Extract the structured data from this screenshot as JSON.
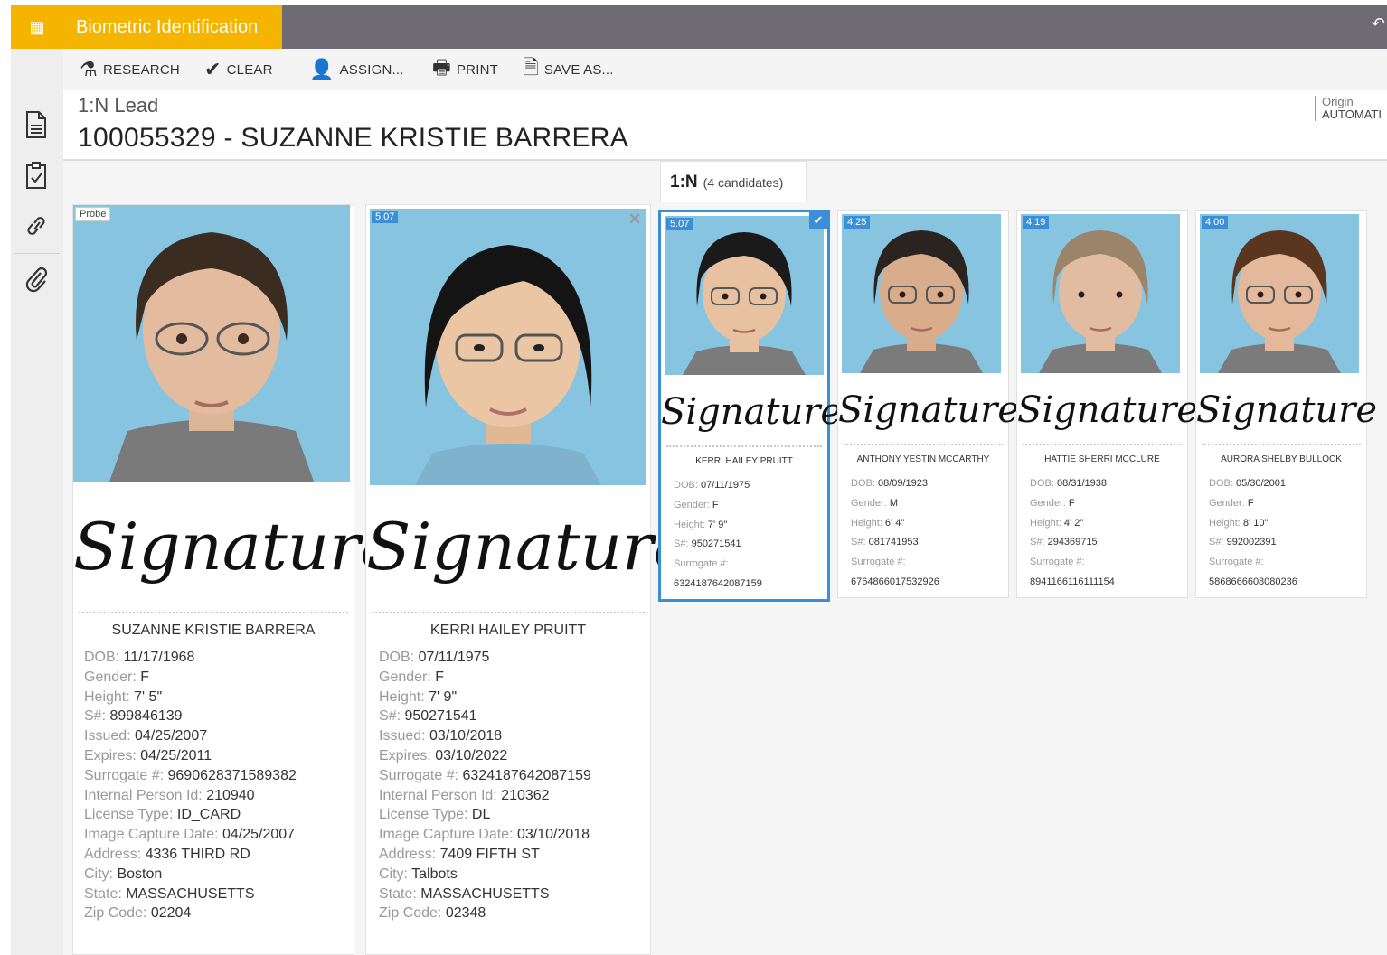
{
  "app": {
    "title": "Biometric Identification"
  },
  "toolbar": {
    "research": "RESEARCH",
    "clear": "CLEAR",
    "assign": "ASSIGN...",
    "print": "PRINT",
    "save_as": "SAVE AS..."
  },
  "header": {
    "lead": "1:N Lead",
    "title": "100055329 - SUZANNE KRISTIE BARRERA",
    "origin_label": "Origin",
    "origin_value": "AUTOMATI"
  },
  "tab": {
    "label": "1:N",
    "count": "(4 candidates)"
  },
  "signature_text": "Signature",
  "colors": {
    "accent": "#f5b400",
    "topbar": "#6f6b73",
    "selection": "#3b8fd6",
    "photo_bg": "#86c4e0"
  },
  "probe": {
    "badge": "Probe",
    "name": "SUZANNE KRISTIE BARRERA",
    "fields": [
      {
        "k": "DOB: ",
        "v": "11/17/1968"
      },
      {
        "k": "Gender: ",
        "v": "F"
      },
      {
        "k": "Height: ",
        "v": "7' 5\""
      },
      {
        "k": "S#: ",
        "v": "899846139"
      },
      {
        "k": "Issued: ",
        "v": "04/25/2007"
      },
      {
        "k": "Expires: ",
        "v": "04/25/2011"
      },
      {
        "k": "Surrogate #: ",
        "v": "9690628371589382"
      },
      {
        "k": "Internal Person Id: ",
        "v": "210940"
      },
      {
        "k": "License Type: ",
        "v": "ID_CARD"
      },
      {
        "k": "Image Capture Date: ",
        "v": "04/25/2007"
      },
      {
        "k": "Address: ",
        "v": "4336 THIRD RD"
      },
      {
        "k": "City: ",
        "v": "Boston"
      },
      {
        "k": "State: ",
        "v": "MASSACHUSETTS"
      },
      {
        "k": "Zip Code: ",
        "v": "02204"
      }
    ]
  },
  "match": {
    "badge": "5.07",
    "close": "✕",
    "name": "KERRI HAILEY PRUITT",
    "fields": [
      {
        "k": "DOB: ",
        "v": "07/11/1975"
      },
      {
        "k": "Gender: ",
        "v": "F"
      },
      {
        "k": "Height: ",
        "v": "7' 9\""
      },
      {
        "k": "S#: ",
        "v": "950271541"
      },
      {
        "k": "Issued: ",
        "v": "03/10/2018"
      },
      {
        "k": "Expires: ",
        "v": "03/10/2022"
      },
      {
        "k": "Surrogate #: ",
        "v": "6324187642087159"
      },
      {
        "k": "Internal Person Id: ",
        "v": "210362"
      },
      {
        "k": "License Type: ",
        "v": "DL"
      },
      {
        "k": "Image Capture Date: ",
        "v": "03/10/2018"
      },
      {
        "k": "Address: ",
        "v": "7409 FIFTH ST"
      },
      {
        "k": "City: ",
        "v": "Talbots"
      },
      {
        "k": "State: ",
        "v": "MASSACHUSETTS"
      },
      {
        "k": "Zip Code: ",
        "v": "02348"
      }
    ]
  },
  "candidates": [
    {
      "score": "5.07",
      "selected": true,
      "name": "KERRI HAILEY PRUITT",
      "hair": "#1a1a1a",
      "skin": "#e8c2a0",
      "glasses": true,
      "fields": [
        {
          "k": "DOB: ",
          "v": "07/11/1975"
        },
        {
          "k": "Gender: ",
          "v": "F"
        },
        {
          "k": "Height: ",
          "v": "7' 9\""
        },
        {
          "k": "S#: ",
          "v": "950271541"
        },
        {
          "k": "Surrogate #: ",
          "v": ""
        },
        {
          "k": "",
          "v": "6324187642087159"
        }
      ]
    },
    {
      "score": "4.25",
      "selected": false,
      "name": "ANTHONY YESTIN MCCARTHY",
      "hair": "#2a2320",
      "skin": "#d9ad8c",
      "glasses": true,
      "fields": [
        {
          "k": "DOB: ",
          "v": "08/09/1923"
        },
        {
          "k": "Gender: ",
          "v": "M"
        },
        {
          "k": "Height: ",
          "v": "6' 4\""
        },
        {
          "k": "S#: ",
          "v": "081741953"
        },
        {
          "k": "Surrogate #: ",
          "v": ""
        },
        {
          "k": "",
          "v": "6764866017532926"
        }
      ]
    },
    {
      "score": "4.19",
      "selected": false,
      "name": "HATTIE SHERRI MCCLURE",
      "hair": "#9c8468",
      "skin": "#e2bca0",
      "glasses": false,
      "fields": [
        {
          "k": "DOB: ",
          "v": "08/31/1938"
        },
        {
          "k": "Gender: ",
          "v": "F"
        },
        {
          "k": "Height: ",
          "v": "4' 2\""
        },
        {
          "k": "S#: ",
          "v": "294369715"
        },
        {
          "k": "Surrogate #: ",
          "v": ""
        },
        {
          "k": "",
          "v": "8941166116111154"
        }
      ]
    },
    {
      "score": "4.00",
      "selected": false,
      "name": "AURORA SHELBY BULLOCK",
      "hair": "#5a3620",
      "skin": "#e4b89a",
      "glasses": true,
      "fields": [
        {
          "k": "DOB: ",
          "v": "05/30/2001"
        },
        {
          "k": "Gender: ",
          "v": "F"
        },
        {
          "k": "Height: ",
          "v": "8' 10\""
        },
        {
          "k": "S#: ",
          "v": "992002391"
        },
        {
          "k": "Surrogate #: ",
          "v": ""
        },
        {
          "k": "",
          "v": "5868666608080236"
        }
      ]
    }
  ]
}
